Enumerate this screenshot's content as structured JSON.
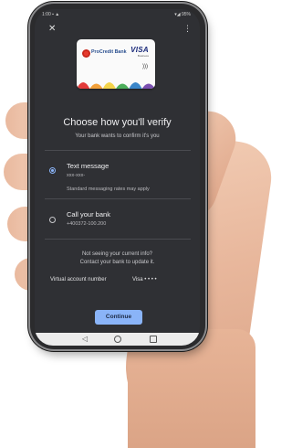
{
  "status_bar": {
    "left": "1:00 ▪ ▲",
    "right": "▾◢ 95%"
  },
  "card": {
    "bank_name": "ProCredit Bank",
    "network": "VISA",
    "network_sub": "Business",
    "stripe_colors": [
      "#e23b3b",
      "#f2a03a",
      "#f3d34a",
      "#4cae5b",
      "#3a86c9",
      "#7a4fb0"
    ]
  },
  "dialog": {
    "title": "Choose how you'll verify",
    "subtitle": "Your bank wants to confirm it's you",
    "options": [
      {
        "label": "Text message",
        "detail": "xxx-xxx-",
        "note": "Standard messaging rates may apply",
        "selected": true
      },
      {
        "label": "Call your bank",
        "detail": "+400372-100.200",
        "selected": false
      }
    ],
    "info_line1": "Not seeing your current info?",
    "info_line2": "Contact your bank to update it.",
    "virtual_account_label": "Virtual account number",
    "virtual_account_value": "Visa • • • •",
    "continue_label": "Continue"
  },
  "icons": {
    "close": "close-icon",
    "menu": "more-vert-icon",
    "nav_back": "back-triangle-icon",
    "nav_home": "home-circle-icon",
    "nav_recent": "recent-square-icon"
  },
  "colors": {
    "accent": "#8ab4f8",
    "screen_background": "#2f3034"
  }
}
